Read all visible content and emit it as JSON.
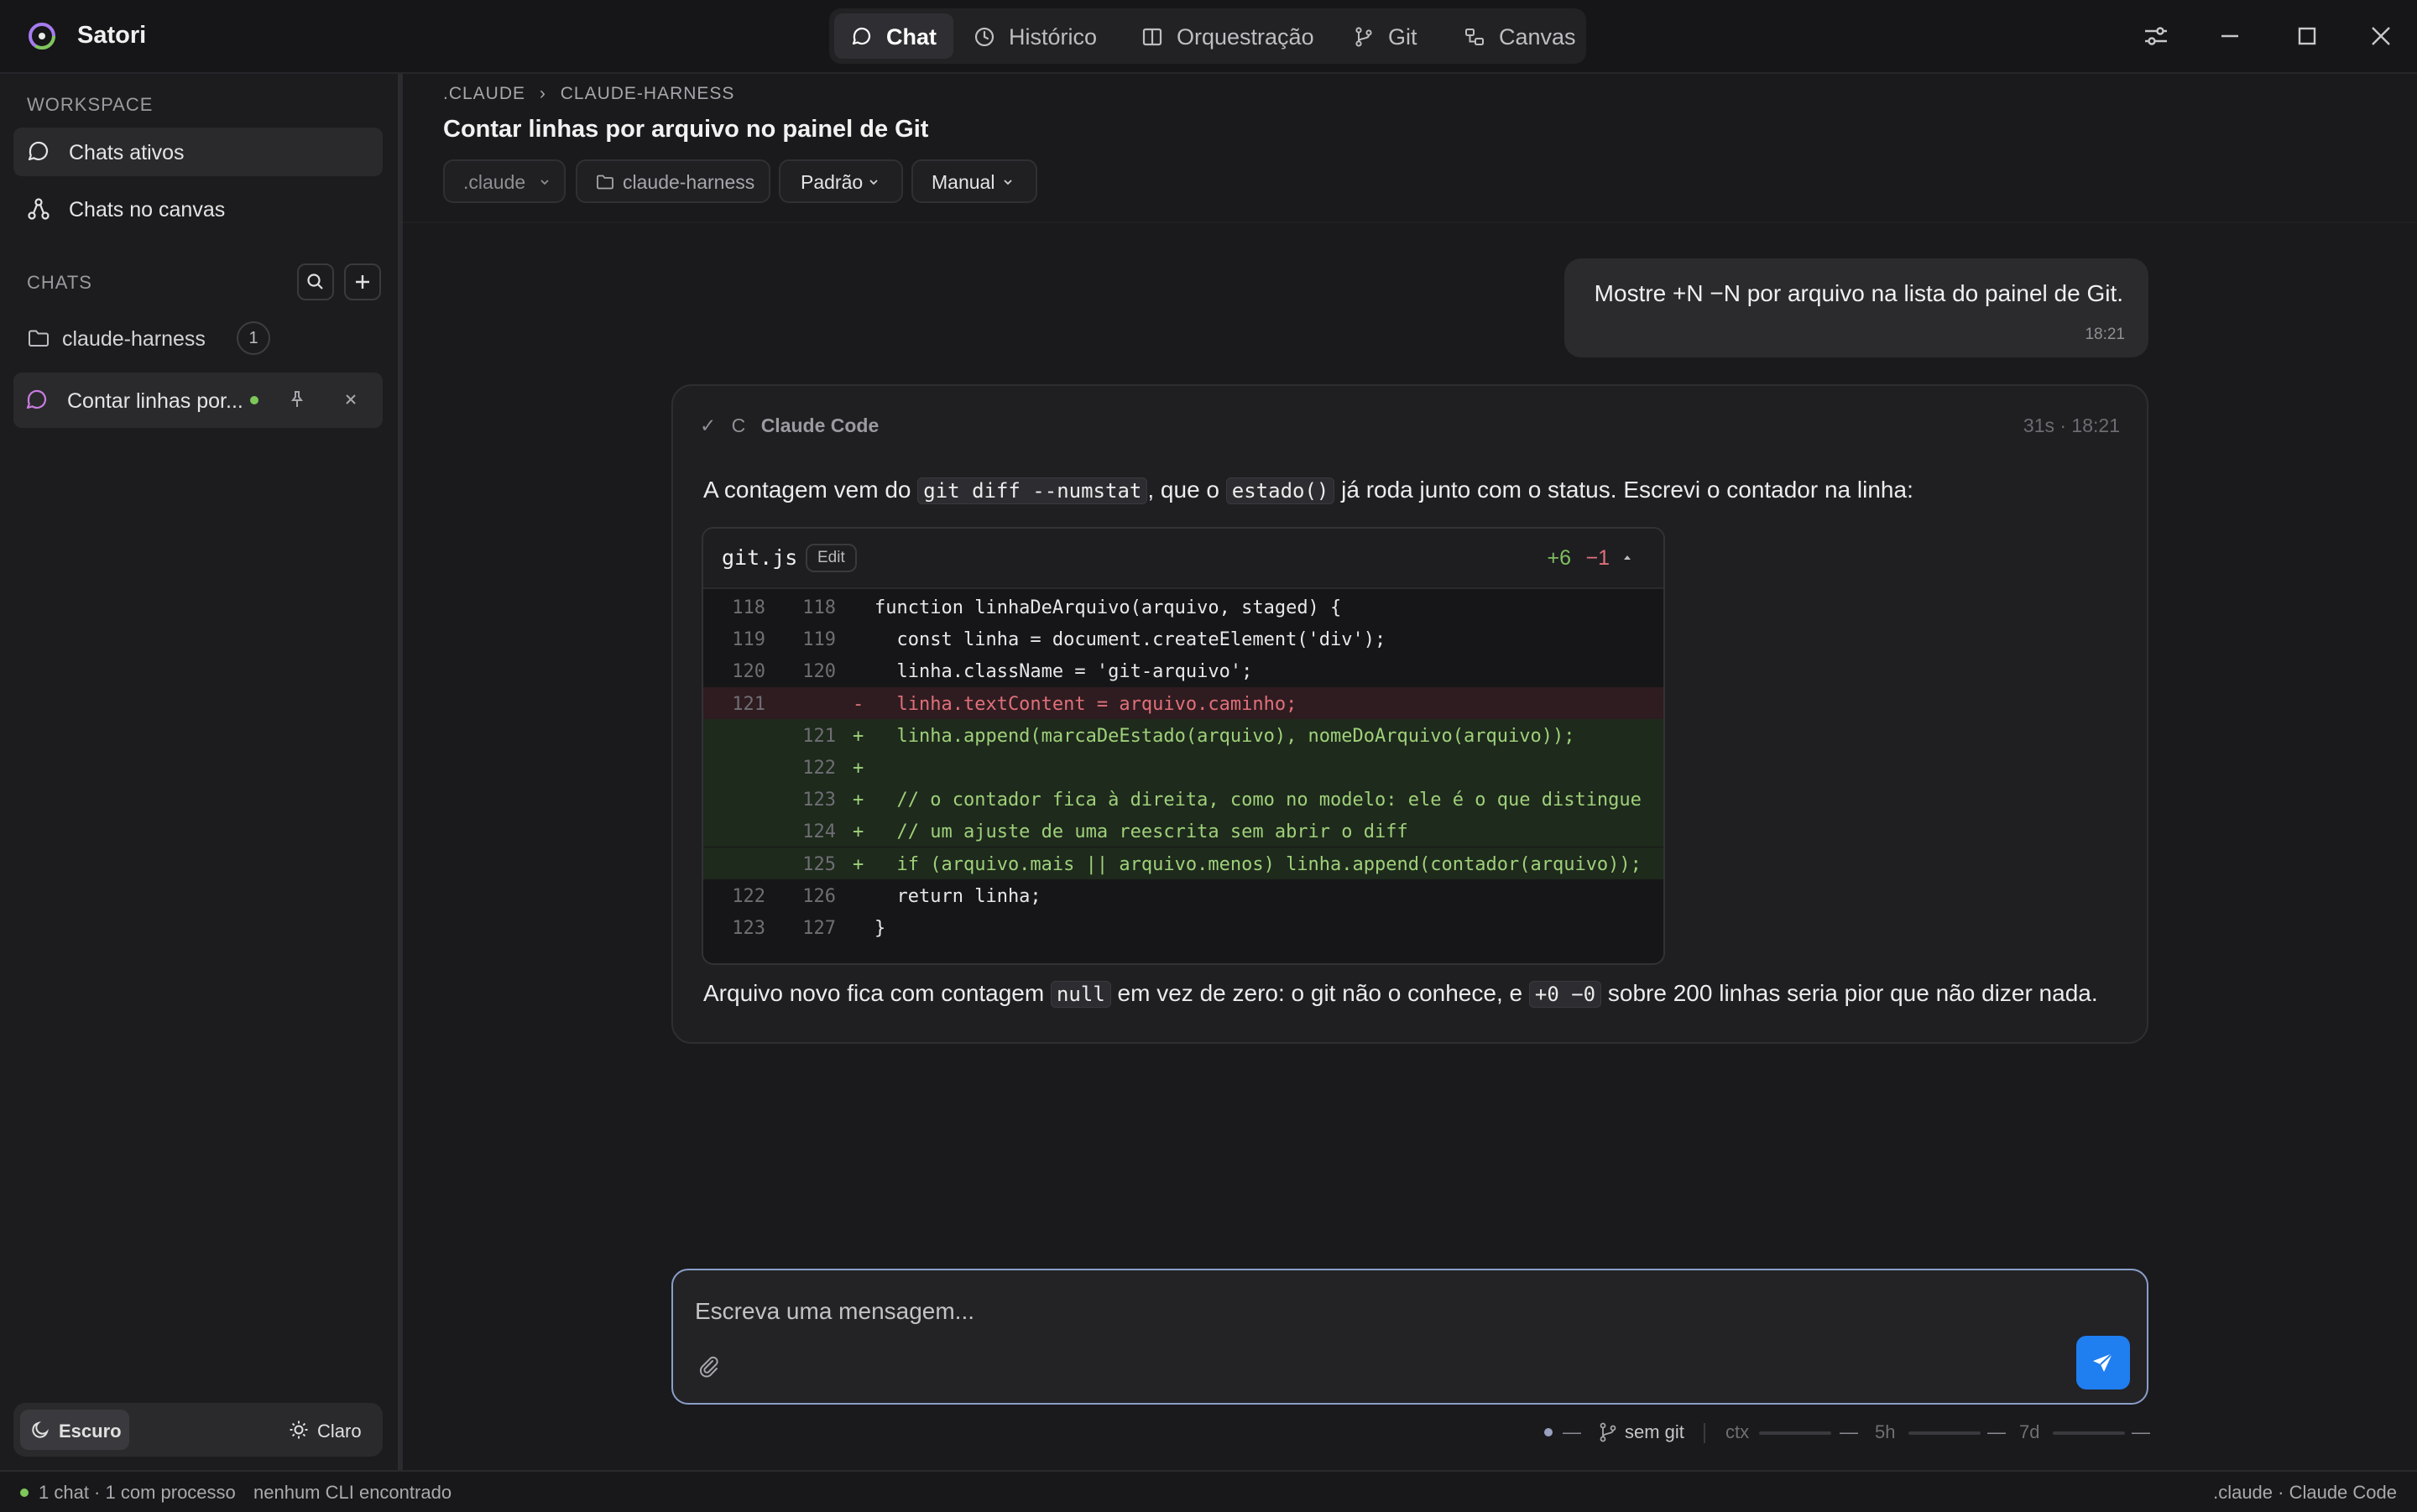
{
  "app": {
    "name": "Satori"
  },
  "nav": {
    "tabs": [
      {
        "label": "Chat",
        "icon": "chat-bubble-icon",
        "active": true
      },
      {
        "label": "Histórico",
        "icon": "clock-icon"
      },
      {
        "label": "Orquestração",
        "icon": "columns-icon"
      },
      {
        "label": "Git",
        "icon": "git-branch-icon"
      },
      {
        "label": "Canvas",
        "icon": "canvas-icon"
      }
    ]
  },
  "sidebar": {
    "workspace_label": "WORKSPACE",
    "workspace_items": [
      {
        "label": "Chats ativos",
        "icon": "chat-bubble-icon",
        "active": true
      },
      {
        "label": "Chats no canvas",
        "icon": "network-icon"
      }
    ],
    "chats_label": "CHATS",
    "folder": {
      "label": "claude-harness",
      "count": "1",
      "icon": "folder-icon"
    },
    "active_chat": {
      "label": "Contar linhas por...",
      "status_color": "#7ec75a"
    },
    "theme": {
      "dark_label": "Escuro",
      "light_label": "Claro",
      "selected": "dark"
    }
  },
  "header": {
    "breadcrumb": {
      "root": ".CLAUDE",
      "sep": "›",
      "child": "CLAUDE-HARNESS"
    },
    "title": "Contar linhas por arquivo no painel de Git",
    "pills": {
      "scope": ".claude",
      "folder": "claude-harness",
      "mode": "Padrão",
      "approval": "Manual"
    }
  },
  "user_message": {
    "text": "Mostre +N −N por arquivo na lista do painel de Git.",
    "time": "18:21"
  },
  "assistant": {
    "check": "✓",
    "initial": "C",
    "name": "Claude Code",
    "meta": "31s · 18:21",
    "intro": {
      "t1": "A contagem vem do ",
      "c1": "git diff --numstat",
      "t2": ", que o ",
      "c2": "estado()",
      "t3": " já roda junto com o status. Escrevi o contador na linha:"
    },
    "diff": {
      "file": "git.js",
      "edit_label": "Edit",
      "added": "+6",
      "removed": "−1",
      "lines": [
        {
          "old": "118",
          "new": "118",
          "mark": "",
          "type": "ctx",
          "code": "function linhaDeArquivo(arquivo, staged) {"
        },
        {
          "old": "119",
          "new": "119",
          "mark": "",
          "type": "ctx",
          "code": "  const linha = document.createElement('div');"
        },
        {
          "old": "120",
          "new": "120",
          "mark": "",
          "type": "ctx",
          "code": "  linha.className = 'git-arquivo';"
        },
        {
          "old": "121",
          "new": "",
          "mark": "-",
          "type": "del",
          "code": "  linha.textContent = arquivo.caminho;"
        },
        {
          "old": "",
          "new": "121",
          "mark": "+",
          "type": "add",
          "code": "  linha.append(marcaDeEstado(arquivo), nomeDoArquivo(arquivo));"
        },
        {
          "old": "",
          "new": "122",
          "mark": "+",
          "type": "add",
          "code": ""
        },
        {
          "old": "",
          "new": "123",
          "mark": "+",
          "type": "add",
          "code": "  // o contador fica à direita, como no modelo: ele é o que distingue"
        },
        {
          "old": "",
          "new": "124",
          "mark": "+",
          "type": "add",
          "code": "  // um ajuste de uma reescrita sem abrir o diff"
        },
        {
          "old": "",
          "new": "125",
          "mark": "+",
          "type": "add",
          "code": "  if (arquivo.mais || arquivo.menos) linha.append(contador(arquivo));"
        },
        {
          "old": "122",
          "new": "126",
          "mark": "",
          "type": "ctx",
          "code": "  return linha;"
        },
        {
          "old": "123",
          "new": "127",
          "mark": "",
          "type": "ctx",
          "code": "}"
        }
      ]
    },
    "outro": {
      "t1": "Arquivo novo fica com contagem ",
      "c1": "null",
      "t2": " em vez de zero: o git não o conhece, e ",
      "c2": "+0 −0",
      "t3": " sobre 200 linhas seria pior que não dizer nada."
    }
  },
  "composer": {
    "placeholder": "Escreva uma mensagem..."
  },
  "status": {
    "dash": "—",
    "git": "sem git",
    "ctx_label": "ctx",
    "h5_label": "5h",
    "d7_label": "7d"
  },
  "footer": {
    "left": "1 chat · 1 com processo",
    "cli": "nenhum CLI encontrado",
    "right": ".claude · Claude Code"
  },
  "colors": {
    "accent": "#1f7ef0",
    "added": "#9fd07a",
    "removed": "#e0707a",
    "status_ok": "#7ec75a"
  }
}
